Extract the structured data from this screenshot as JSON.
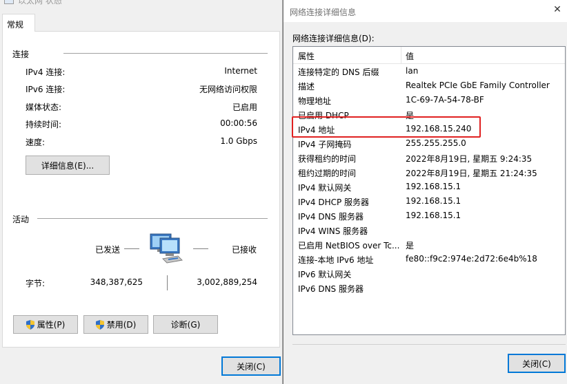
{
  "left": {
    "title": "以太网 状态",
    "tab": "常规",
    "connection_group": "连接",
    "rows": [
      {
        "label": "IPv4 连接:",
        "value": "Internet"
      },
      {
        "label": "IPv6 连接:",
        "value": "无网络访问权限"
      },
      {
        "label": "媒体状态:",
        "value": "已启用"
      },
      {
        "label": "持续时间:",
        "value": "00:00:56"
      },
      {
        "label": "速度:",
        "value": "1.0 Gbps"
      }
    ],
    "details_button": "详细信息(E)...",
    "activity_group": "活动",
    "sent_label": "已发送",
    "received_label": "已接收",
    "bytes_label": "字节:",
    "bytes_sent": "348,387,625",
    "bytes_received": "3,002,889,254",
    "properties_button": "属性(P)",
    "disable_button": "禁用(D)",
    "diagnose_button": "诊断(G)",
    "close_button": "关闭(C)"
  },
  "right": {
    "title": "网络连接详细信息",
    "list_heading": "网络连接详细信息(D):",
    "col_property": "属性",
    "col_value": "值",
    "rows": [
      {
        "property": "连接特定的 DNS 后缀",
        "value": "lan"
      },
      {
        "property": "描述",
        "value": "Realtek PCIe GbE Family Controller"
      },
      {
        "property": "物理地址",
        "value": "1C-69-7A-54-78-BF"
      },
      {
        "property": "已启用 DHCP",
        "value": "是"
      },
      {
        "property": "IPv4 地址",
        "value": "192.168.15.240"
      },
      {
        "property": "IPv4 子网掩码",
        "value": "255.255.255.0"
      },
      {
        "property": "获得租约的时间",
        "value": "2022年8月19日, 星期五 9:24:35"
      },
      {
        "property": "租约过期的时间",
        "value": "2022年8月19日, 星期五 21:24:35"
      },
      {
        "property": "IPv4 默认网关",
        "value": "192.168.15.1"
      },
      {
        "property": "IPv4 DHCP 服务器",
        "value": "192.168.15.1"
      },
      {
        "property": "IPv4 DNS 服务器",
        "value": "192.168.15.1"
      },
      {
        "property": "IPv4 WINS 服务器",
        "value": ""
      },
      {
        "property": "已启用 NetBIOS over Tc...",
        "value": "是"
      },
      {
        "property": "连接-本地 IPv6 地址",
        "value": "fe80::f9c2:974e:2d72:6e4b%18"
      },
      {
        "property": "IPv6 默认网关",
        "value": ""
      },
      {
        "property": "IPv6 DNS 服务器",
        "value": ""
      }
    ],
    "close_button": "关闭(C)"
  },
  "colors": {
    "highlight": "#e02020",
    "accent": "#0078d7"
  },
  "icons": [
    "window-icon",
    "network-computers-icon",
    "shield-icon",
    "close-icon"
  ]
}
